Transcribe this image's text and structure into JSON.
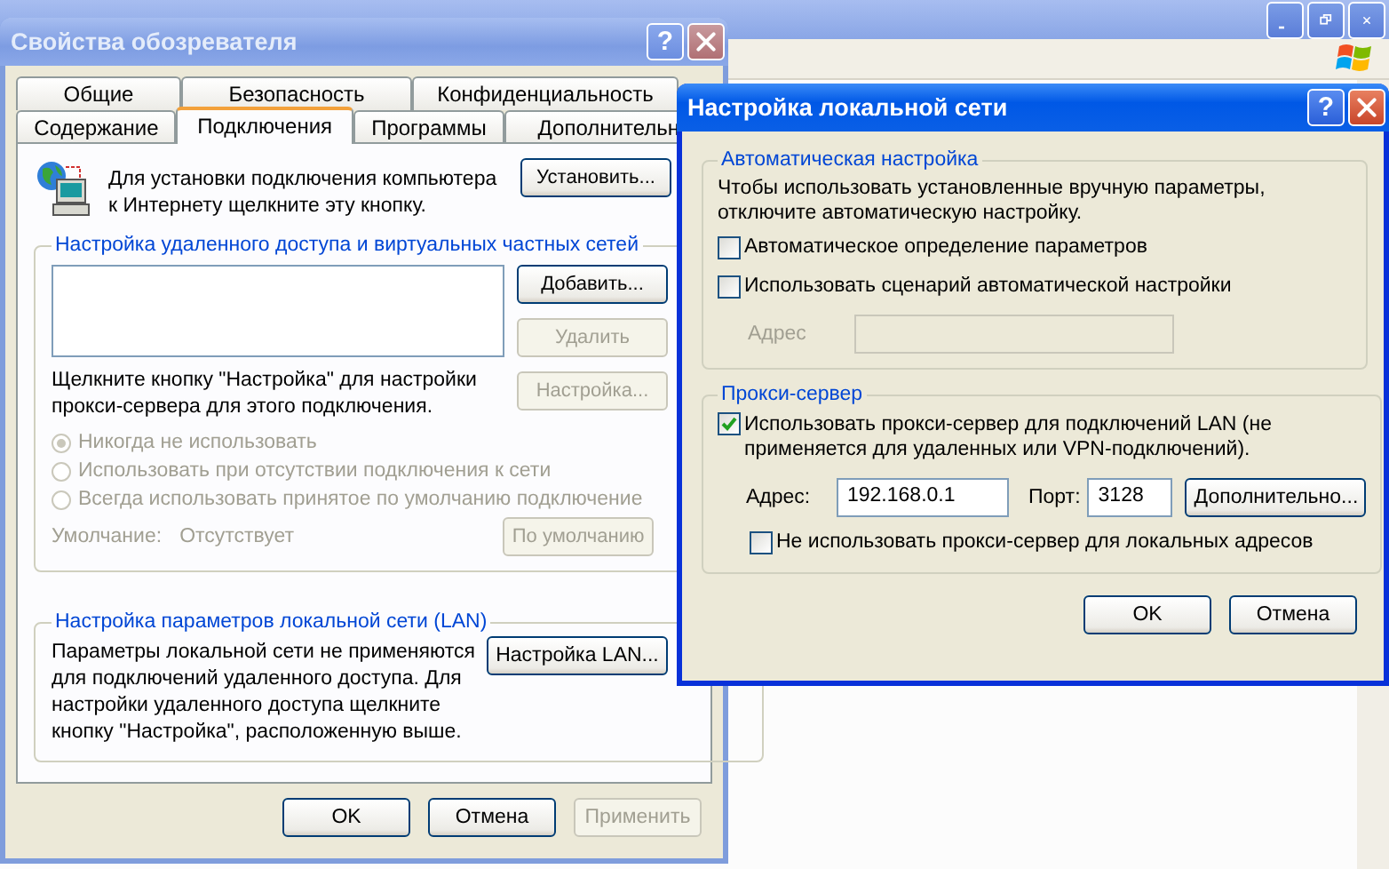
{
  "internet_options": {
    "title": "Свойства обозревателя",
    "help_button": "?",
    "tab_rows": [
      {
        "tabs": [
          {
            "label": "Общие",
            "selected": false
          },
          {
            "label": "Безопасность",
            "selected": false
          },
          {
            "label": "Конфиденциальность",
            "selected": false
          }
        ]
      },
      {
        "tabs": [
          {
            "label": "Содержание",
            "selected": false
          },
          {
            "label": "Подключения",
            "selected": true
          },
          {
            "label": "Программы",
            "selected": false
          },
          {
            "label": "Дополнительн",
            "selected": false
          }
        ]
      }
    ],
    "setup": {
      "text": "Для установки подключения компьютера к Интернету щелкните эту кнопку.",
      "button": {
        "label": "Установить...",
        "disabled": false
      }
    },
    "dialup_group": {
      "title": "Настройка удаленного доступа и виртуальных частных сетей",
      "buttons": [
        {
          "label": "Добавить...",
          "disabled": false
        },
        {
          "label": "Удалить",
          "disabled": true
        },
        {
          "label": "Настройка...",
          "disabled": true
        }
      ],
      "hint": "Щелкните кнопку \"Настройка\" для настройки прокси-сервера для этого подключения.",
      "radios": [
        {
          "label": "Никогда не использовать",
          "selected": true,
          "disabled": true
        },
        {
          "label": "Использовать при отсутствии подключения к сети",
          "selected": false,
          "disabled": true
        },
        {
          "label": "Всегда использовать принятое по умолчанию подключение",
          "selected": false,
          "disabled": true
        }
      ],
      "default_label": "Умолчание:",
      "default_value": "Отсутствует",
      "default_button": {
        "label": "По умолчанию",
        "disabled": true
      }
    },
    "lan_group": {
      "title": "Настройка параметров локальной сети (LAN)",
      "text": "Параметры локальной сети не применяются для подключений удаленного доступа. Для настройки удаленного доступа щелкните кнопку \"Настройка\", расположенную выше.",
      "button": {
        "label": "Настройка LAN...",
        "disabled": false
      }
    },
    "buttons": [
      {
        "label": "OK",
        "disabled": false
      },
      {
        "label": "Отмена",
        "disabled": false
      },
      {
        "label": "Применить",
        "disabled": true
      }
    ]
  },
  "lan_dialog": {
    "title": "Настройка локальной сети",
    "help_button": "?",
    "auto_group": {
      "title": "Автоматическая настройка",
      "text": "Чтобы использовать установленные вручную параметры, отключите автоматическую настройку.",
      "checkboxes": [
        {
          "label": "Автоматическое определение параметров",
          "checked": false
        },
        {
          "label": "Использовать сценарий автоматической настройки",
          "checked": false
        }
      ],
      "address": {
        "label": "Адрес",
        "disabled": true
      }
    },
    "proxy_group": {
      "title": "Прокси-сервер",
      "use_proxy": {
        "label": "Использовать прокси-сервер для подключений LAN (не применяется для удаленных или VPN-подключений).",
        "checked": true
      },
      "address_label": "Адрес:",
      "address_value": "192.168.0.1",
      "port_label": "Порт:",
      "port_value": "3128",
      "advanced_button": {
        "label": "Дополнительно...",
        "disabled": false
      },
      "bypass": {
        "label": "Не использовать прокси-сервер для локальных адресов",
        "checked": false
      }
    },
    "buttons": [
      {
        "label": "OK",
        "disabled": false
      },
      {
        "label": "Отмена",
        "disabled": false
      }
    ]
  }
}
